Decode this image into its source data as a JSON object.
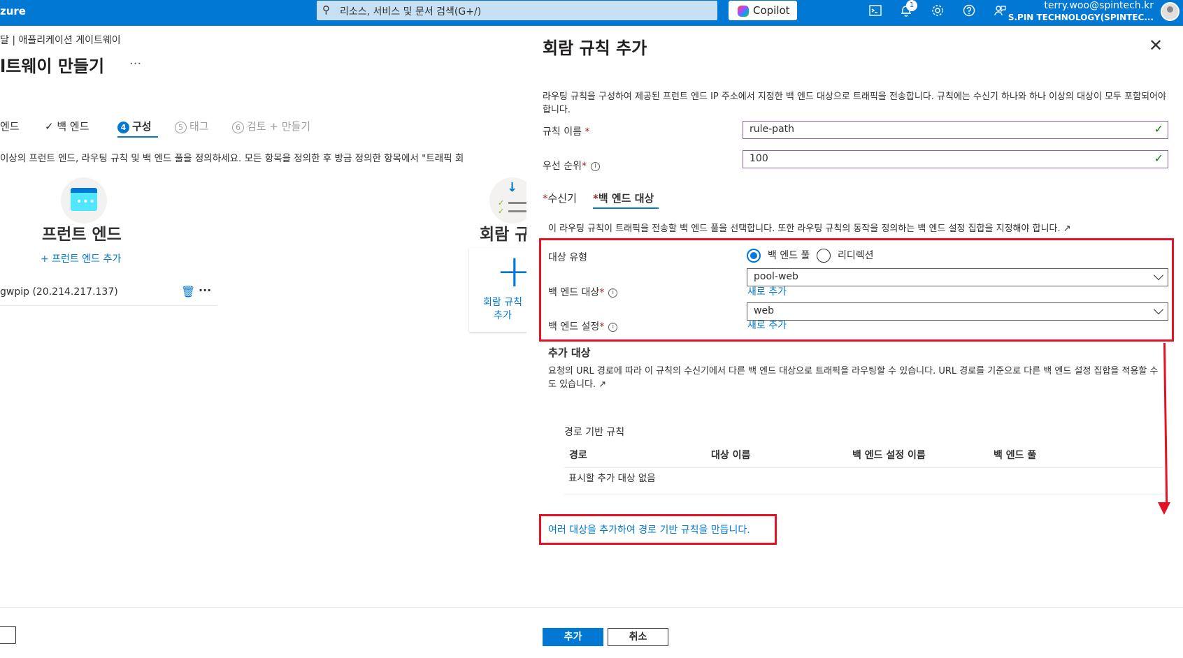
{
  "topbar": {
    "brand": "zure",
    "search_placeholder": "리소스, 서비스 및 문서 검색(G+/)",
    "copilot_label": "Copilot",
    "notification_count": "1",
    "user_email": "terry.woo@spintech.kr",
    "user_tenant": "S.PIN TECHNOLOGY(SPINTEC..."
  },
  "left": {
    "breadcrumb": "달 | 애플리케이션 게이트웨이",
    "title": "l트웨이 만들기",
    "more": "···",
    "steps": [
      {
        "label": "엔드"
      },
      {
        "label": "백 엔드"
      },
      {
        "num": "4",
        "label": "구성"
      },
      {
        "num": "5",
        "label": "태그"
      },
      {
        "num": "6",
        "label": "검토 + 만들기"
      }
    ],
    "description": "이상의 프런트 엔드, 라우팅 규칙 및 백 엔드 풀을 정의하세요. 모든 항목을 정의한 후 방금 정의한 항목에서 \"트래픽 회",
    "frontend_title": "프런트 엔드",
    "frontend_add": "+ 프런트 엔드 추가",
    "frontend_item": "gwpip (20.214.217.137)",
    "rules_title": "회람 규",
    "rules_add": "회람 규칙 추가"
  },
  "panel": {
    "title": "회람 규칙 추가",
    "description": "라우팅 규칙을 구성하여 제공된 프런트 엔드 IP 주소에서 지정한 백 엔드 대상으로 트래픽을 전송합니다. 규칙에는 수신기 하나와 하나 이상의 대상이 모두 포함되어야 합니다.",
    "rule_name_label": "규칙 이름",
    "rule_name_value": "rule-path",
    "priority_label": "우선 순위",
    "priority_value": "100",
    "tab_listener": "수신기",
    "tab_backend": "백 엔드 대상",
    "tab_desc": "이 라우팅 규칙이 트래픽을 전송할 백 엔드 풀을 선택합니다. 또한 라우팅 규칙의 동작을 정의하는 백 엔드 설정 집합을 지정해야 합니다.",
    "target_type_label": "대상 유형",
    "radio_backend_pool": "백 엔드 풀",
    "radio_redirect": "리디렉션",
    "backend_target_label": "백 엔드 대상",
    "backend_target_value": "pool-web",
    "add_new_1": "새로 추가",
    "backend_settings_label": "백 엔드 설정",
    "backend_settings_value": "web",
    "add_new_2": "새로 추가",
    "additional_title": "추가 대상",
    "additional_desc": "요청의 URL 경로에 따라 이 규칙의 수신기에서 다른 백 엔드 대상으로 트래픽을 라우팅할 수 있습니다. URL 경로를 기준으로 다른 백 엔드 설정 집합을 적용할 수도 있습니다.",
    "path_rules_caption": "경로 기반 규칙",
    "columns": [
      "경로",
      "대상 이름",
      "백 엔드 설정 이름",
      "백 엔드 풀"
    ],
    "empty_row": "표시할 추가 대상 없음",
    "multi_target_link": "여러 대상을 추가하여 경로 기반 규칙을 만듭니다.",
    "add_button": "추가",
    "cancel_button": "취소"
  },
  "colors": {
    "accent": "#0078d4",
    "highlight": "#e81123",
    "valid": "#107c10"
  }
}
